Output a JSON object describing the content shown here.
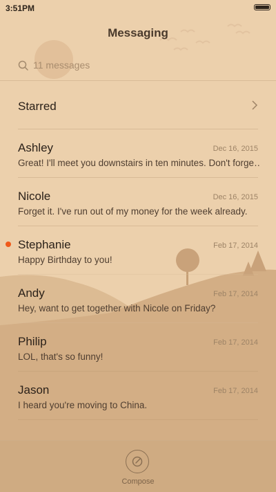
{
  "status_bar": {
    "time": "3:51PM",
    "battery_icon": "battery-icon"
  },
  "header": {
    "title": "Messaging"
  },
  "search": {
    "placeholder": "11 messages",
    "icon": "search-icon"
  },
  "starred": {
    "label": "Starred",
    "icon": "chevron-right-icon"
  },
  "conversations": [
    {
      "name": "Ashley",
      "date": "Dec 16, 2015",
      "preview": "Great! I'll meet you downstairs in ten minutes. Don't forge…",
      "unread": false
    },
    {
      "name": "Nicole",
      "date": "Dec 16, 2015",
      "preview": "Forget it. I've run out of my money for the week already.",
      "unread": false
    },
    {
      "name": "Stephanie",
      "date": "Feb 17, 2014",
      "preview": "Happy Birthday to you!",
      "unread": true
    },
    {
      "name": "Andy",
      "date": "Feb 17, 2014",
      "preview": "Hey, want to get together with Nicole on Friday?",
      "unread": false
    },
    {
      "name": "Philip",
      "date": "Feb 17, 2014",
      "preview": "LOL, that's so funny!",
      "unread": false
    },
    {
      "name": "Jason",
      "date": "Feb 17, 2014",
      "preview": "I heard you're moving to China.",
      "unread": false
    }
  ],
  "compose": {
    "label": "Compose",
    "icon": "compose-icon"
  },
  "colors": {
    "background": "#ecd0ac",
    "hills": "#d7b48c",
    "unread_dot": "#f05a1a"
  }
}
